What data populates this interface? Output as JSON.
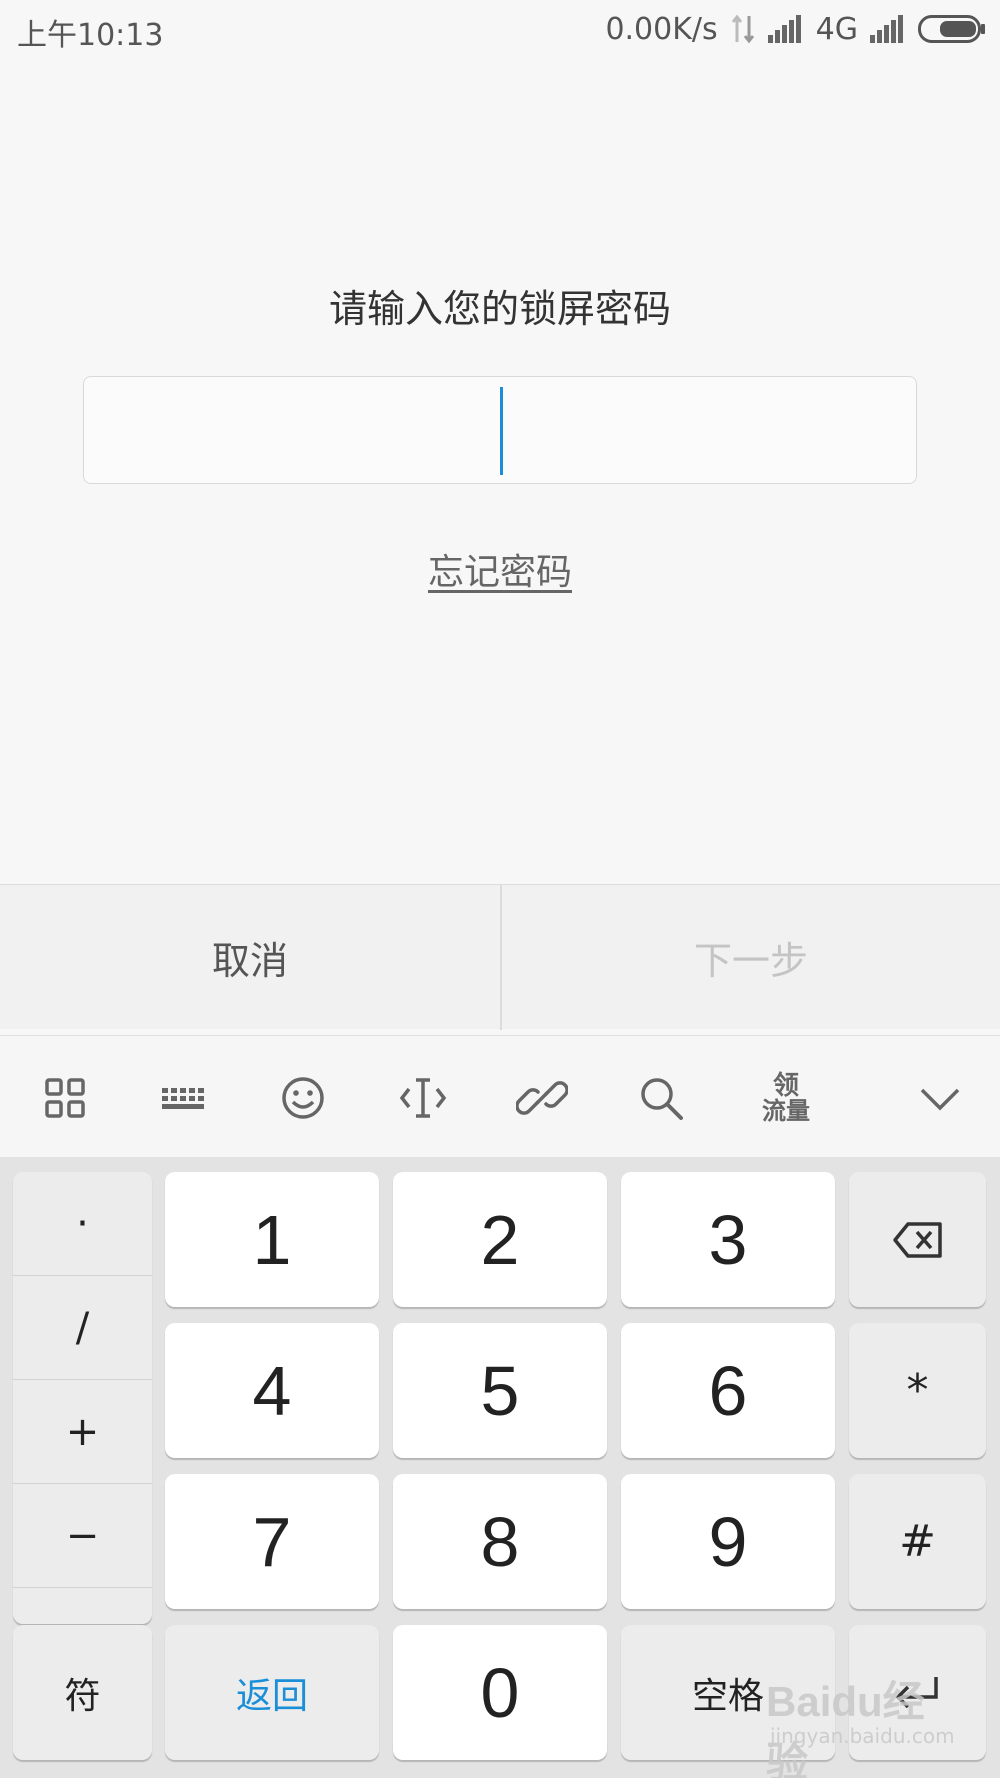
{
  "status_bar": {
    "time": "上午10:13",
    "net_speed": "0.00K/s",
    "network_type": "4G",
    "icons": [
      "data-transfer-icon",
      "signal-strength-icon",
      "signal-strength-icon",
      "battery-icon"
    ]
  },
  "prompt": {
    "title": "请输入您的锁屏密码",
    "input_value": "",
    "forgot_link": "忘记密码"
  },
  "actions": {
    "cancel": "取消",
    "next": "下一步"
  },
  "keyboard_toolbar": {
    "icons": [
      "grid-apps-icon",
      "keyboard-icon",
      "emoji-icon",
      "text-cursor-icon",
      "link-icon",
      "search-icon",
      "flow-gift-icon",
      "collapse-chevron-icon"
    ],
    "flow_badge_top": "领",
    "flow_badge_bottom": "流量"
  },
  "keypad": {
    "symbols": [
      "·",
      "/",
      "+",
      "−"
    ],
    "rows": [
      [
        "1",
        "2",
        "3"
      ],
      [
        "4",
        "5",
        "6"
      ],
      [
        "7",
        "8",
        "9"
      ]
    ],
    "right_column": [
      "backspace",
      "*",
      "#"
    ],
    "bottom": {
      "symbols_key": "符",
      "return_key": "返回",
      "zero_key": "0",
      "space_key": "空格"
    }
  },
  "watermark": {
    "brand": "Baidu经验",
    "url": "jingyan.baidu.com"
  },
  "colors": {
    "accent": "#1a8fd8",
    "background": "#f7f7f7",
    "keypad_bg": "#e3e3e3"
  }
}
